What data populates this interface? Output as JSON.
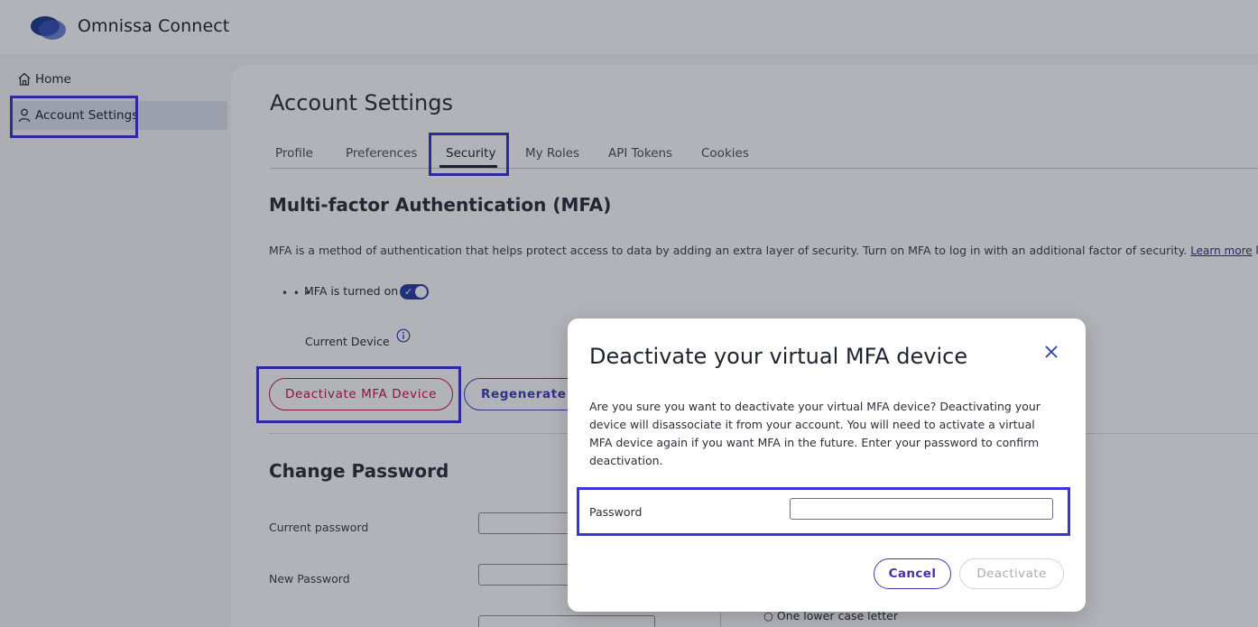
{
  "header": {
    "app_name": "Omnissa Connect",
    "logo_icon": "omnissa-logo-icon",
    "logo_color": "#1f3a8f"
  },
  "sidebar": {
    "items": [
      {
        "label": "Home",
        "icon": "home-icon"
      },
      {
        "label": "Account Settings",
        "icon": "user-icon"
      }
    ],
    "active_index": 1
  },
  "page": {
    "title": "Account Settings",
    "tabs": [
      "Profile",
      "Preferences",
      "Security",
      "My Roles",
      "API Tokens",
      "Cookies"
    ],
    "active_tab": "Security"
  },
  "mfa": {
    "title": "Multi-factor Authentication (MFA)",
    "description": "MFA is a method of authentication that helps protect access to data by adding an extra layer of security. Turn on MFA to log in with an additional factor of security.",
    "learn_more": "Learn more",
    "dots": "• • •",
    "status": "MFA is turned on",
    "toggle_on": true,
    "current_device_label": "Current Device",
    "deactivate_button": "Deactivate MFA Device",
    "regenerate_button": "Regenerate R"
  },
  "password": {
    "title": "Change Password",
    "current_label": "Current password",
    "new_label": "New Password",
    "requirement_visible": "○ One lower case letter"
  },
  "modal": {
    "title": "Deactivate your virtual MFA device",
    "body": "Are you sure you want to deactivate your virtual MFA device? Deactivating your device will disassociate it from your account. You will need to activate a virtual MFA device again if you want MFA in the future. Enter your password to confirm deactivation.",
    "password_label": "Password",
    "password_value": "",
    "cancel": "Cancel",
    "confirm": "Deactivate"
  },
  "colors": {
    "highlight": "#3b34d8",
    "danger": "#b2203f",
    "primary": "#4a2fa8",
    "toggle": "#2b3ea8"
  }
}
